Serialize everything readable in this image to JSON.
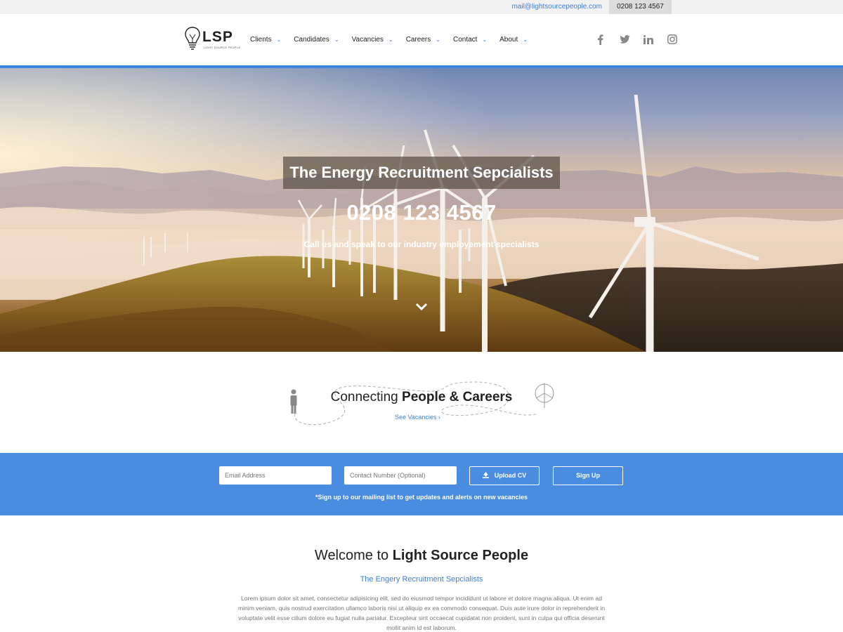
{
  "topbar": {
    "email": "mail@lightsourcepeople.com",
    "phone": "0208 123 4567"
  },
  "header": {
    "logo_text": "LSP",
    "logo_subtext": "LIGHT SOURCE PEOPLE",
    "nav": [
      {
        "label": "Clients"
      },
      {
        "label": "Candidates"
      },
      {
        "label": "Vacancies"
      },
      {
        "label": "Careers"
      },
      {
        "label": "Contact"
      },
      {
        "label": "About"
      }
    ],
    "social_icons": [
      "facebook-icon",
      "twitter-icon",
      "linkedin-icon",
      "instagram-icon"
    ]
  },
  "hero": {
    "title": "The Energy Recruitment Sepcialists",
    "phone": "0208 123 4567",
    "subtitle": "Call us and speak to our industry employement specialists"
  },
  "connecting": {
    "title_prefix": "Connecting ",
    "title_bold": "People & Careers",
    "link": "See Vacancies ›"
  },
  "signup": {
    "email_placeholder": "Email Address",
    "phone_placeholder": "Contact Number (Optional)",
    "upload_label": "Upload CV",
    "signup_label": "Sign Up",
    "note": "*Sign up to our mailing list to get updates and alerts on new vacancies"
  },
  "welcome": {
    "title_prefix": "Welcome to ",
    "title_bold": "Light Source People",
    "subtitle": "The Engery Recruitment Sepcialists",
    "body": "Lorem ipsum dolor sit amet, consectetur adipisicing elit, sed do eiusmod tempor incididunt ut labore et dolore magna aliqua. Ut enim ad minim veniam, quis nostrud exercitation ullamco laboris nisi ut aliquip ex ea commodo consequat. Duis aute irure dolor in reprehenderit in voluptate velit esse cillum dolore eu fugiat nulla pariatur. Excepteur sint occaecat cupidatat non proident, sunt in culpa qui officia deserunt mollit anim id est laborum."
  },
  "colors": {
    "accent": "#3d86dd",
    "signup_band": "#4a8de0",
    "link": "#3d7fd6"
  }
}
